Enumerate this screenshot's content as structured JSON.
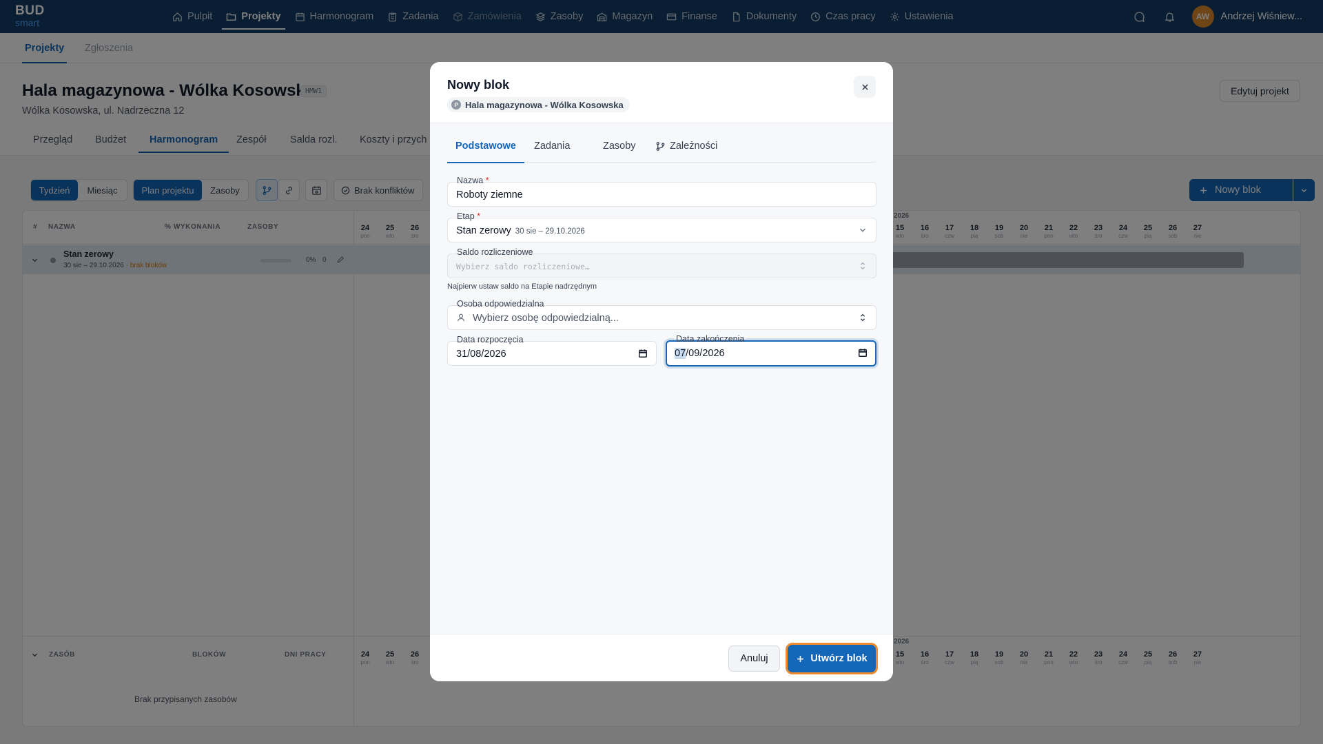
{
  "logo": {
    "line1": "BUD",
    "line2": "smart"
  },
  "nav": {
    "items": [
      {
        "label": "Pulpit",
        "icon": "home-icon"
      },
      {
        "label": "Projekty",
        "icon": "folder-icon"
      },
      {
        "label": "Harmonogram",
        "icon": "calendar-icon"
      },
      {
        "label": "Zadania",
        "icon": "clipboard-icon"
      },
      {
        "label": "Zamówienia",
        "icon": "package-icon"
      },
      {
        "label": "Zasoby",
        "icon": "layers-icon"
      },
      {
        "label": "Magazyn",
        "icon": "warehouse-icon"
      },
      {
        "label": "Finanse",
        "icon": "credit-card-icon"
      },
      {
        "label": "Dokumenty",
        "icon": "document-icon"
      },
      {
        "label": "Czas pracy",
        "icon": "clock-icon"
      },
      {
        "label": "Ustawienia",
        "icon": "gear-icon"
      }
    ],
    "user": {
      "initials": "AW",
      "name": "Andrzej Wiśniew..."
    }
  },
  "subnav": {
    "tabs": [
      "Projekty",
      "Zgłoszenia"
    ]
  },
  "project": {
    "title": "Hala magazynowa - Wólka Kosowska",
    "code": "HMW1",
    "address": "Wólka Kosowska, ul. Nadrzeczna 12",
    "edit_label": "Edytuj projekt",
    "tabs": [
      "Przegląd",
      "Budżet",
      "Harmonogram",
      "Zespół",
      "Salda rozl.",
      "Koszty i przych"
    ]
  },
  "toolbar": {
    "week": "Tydzień",
    "month": "Miesiąc",
    "plan": "Plan projektu",
    "resources": "Zasoby",
    "conflicts": "Brak konfliktów",
    "new_block": "Nowy blok"
  },
  "gantt": {
    "columns": {
      "hash": "#",
      "name": "NAZWA",
      "progress": "% WYKONANIA",
      "resources": "ZASOBY"
    },
    "year": "2026",
    "days_left": [
      {
        "d": "24",
        "w": "pon"
      },
      {
        "d": "25",
        "w": "wto"
      },
      {
        "d": "26",
        "w": "śro"
      }
    ],
    "days_right": [
      {
        "d": "15",
        "w": "wto"
      },
      {
        "d": "16",
        "w": "śro"
      },
      {
        "d": "17",
        "w": "czw"
      },
      {
        "d": "18",
        "w": "pią"
      },
      {
        "d": "19",
        "w": "sob"
      },
      {
        "d": "20",
        "w": "nie"
      },
      {
        "d": "21",
        "w": "pon"
      },
      {
        "d": "22",
        "w": "wto"
      },
      {
        "d": "23",
        "w": "śro"
      },
      {
        "d": "24",
        "w": "czw"
      },
      {
        "d": "25",
        "w": "pią"
      },
      {
        "d": "26",
        "w": "sob"
      },
      {
        "d": "27",
        "w": "nie"
      }
    ],
    "stage": {
      "name": "Stan zerowy",
      "dates": "30 sie – 29.10.2026",
      "warning": "· brak bloków",
      "percent": "0%",
      "resources": "0"
    },
    "res_columns": {
      "resource": "ZASÓB",
      "blocks": "BLOKÓW",
      "workdays": "DNI PRACY"
    },
    "empty_resources": "Brak przypisanych zasobów"
  },
  "modal": {
    "title": "Nowy blok",
    "project_chip": {
      "initial": "P",
      "label": "Hala magazynowa - Wólka Kosowska"
    },
    "tabs": [
      "Podstawowe",
      "Zadania",
      "Zasoby",
      "Zależności"
    ],
    "name": {
      "label": "Nazwa",
      "value": "Roboty ziemne"
    },
    "stage": {
      "label": "Etap",
      "value": "Stan zerowy",
      "range": "30 sie – 29.10.2026"
    },
    "balance": {
      "label": "Saldo rozliczeniowe",
      "placeholder": "Wybierz saldo rozliczeniowe…",
      "hint": "Najpierw ustaw saldo na Etapie nadrzędnym"
    },
    "person": {
      "label": "Osoba odpowiedzialna",
      "placeholder": "Wybierz osobę odpowiedzialną..."
    },
    "start": {
      "label": "Data rozpoczęcia",
      "value": "31/08/2026"
    },
    "end": {
      "label": "Data zakończenia",
      "value_hl": "07",
      "value_rest": "/09/2026"
    },
    "required_mark": "*",
    "cancel_label": "Anuluj",
    "create_label": "Utwórz blok"
  }
}
